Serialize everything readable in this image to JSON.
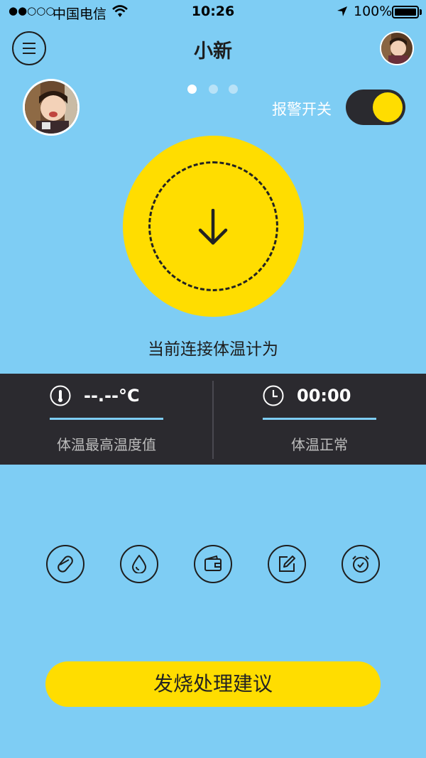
{
  "status_bar": {
    "signal": "●●○○○",
    "carrier": "中国电信",
    "time": "10:26",
    "battery": "100%"
  },
  "nav": {
    "title": "小新"
  },
  "pager": {
    "count": 3,
    "active": 0
  },
  "alarm": {
    "label": "报警开关",
    "on": true
  },
  "connect": {
    "text": "当前连接体温计为"
  },
  "stats": {
    "temperature": {
      "value": "--.--°C",
      "label": "体温最高温度值"
    },
    "time": {
      "value": "00:00",
      "label": "体温正常"
    }
  },
  "tools": [
    {
      "icon": "pill-icon"
    },
    {
      "icon": "water-drop-icon"
    },
    {
      "icon": "wallet-icon"
    },
    {
      "icon": "edit-note-icon"
    },
    {
      "icon": "alarm-clock-icon"
    }
  ],
  "advice": {
    "label": "发烧处理建议"
  },
  "colors": {
    "background": "#7ecdf4",
    "accent_yellow": "#ffdd00",
    "panel_dark": "#2b2a2f"
  }
}
